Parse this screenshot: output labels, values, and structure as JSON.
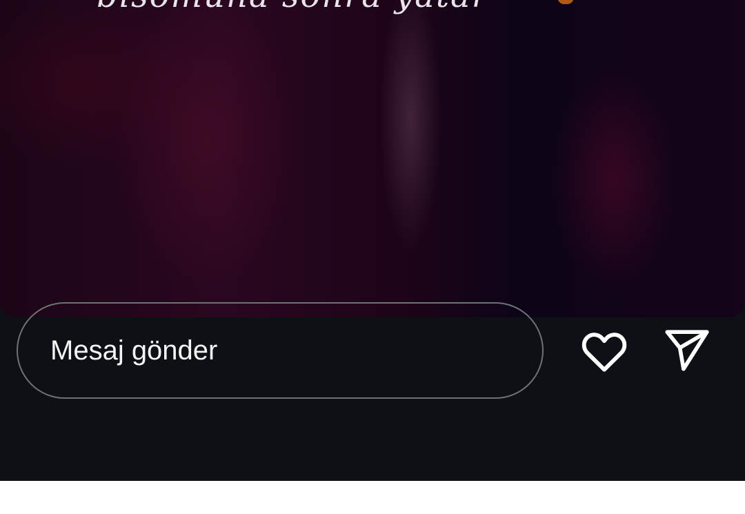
{
  "story": {
    "caption_text": "bisomuna sonra yatar",
    "emoji_color": "#b35a12"
  },
  "reply_bar": {
    "placeholder": "Mesaj gönder",
    "like_icon": "heart-outline",
    "send_icon": "paper-plane"
  },
  "colors": {
    "background": "#0d1115",
    "input_border": "#6f7378",
    "text": "#f3f4f5",
    "bottom_bar": "#ffffff"
  }
}
